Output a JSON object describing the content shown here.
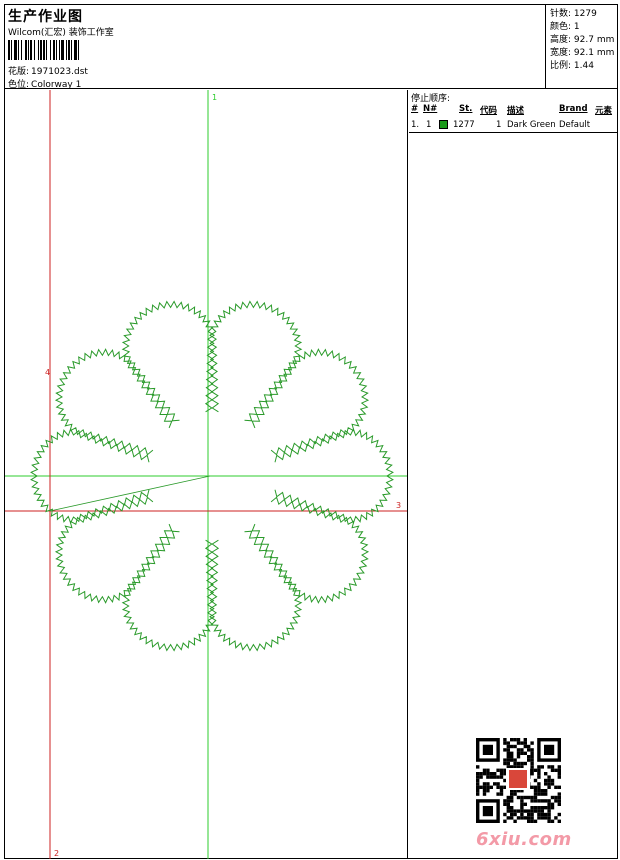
{
  "header": {
    "title": "生产作业图",
    "studio": "Wilcom(汇宏) 装饰工作室",
    "design_label": "花版:",
    "design_file": "1971023.dst",
    "colorway_label": "色位:",
    "colorway": "Colorway 1"
  },
  "stats": {
    "stitches_label": "针数:",
    "stitches": "1279",
    "colors_label": "颜色:",
    "colors": "1",
    "height_label": "高度:",
    "height": "92.7 mm",
    "width_label": "宽度:",
    "width": "92.1 mm",
    "ratio_label": "比例:",
    "ratio": "1.44"
  },
  "canvas": {
    "marker_top": "1",
    "marker_bottom": "2",
    "marker_right": "3",
    "marker_left": "4"
  },
  "stop_sequence": {
    "title": "停止顺序:",
    "headers": [
      "#",
      "N#",
      "St.",
      "代码",
      "描述",
      "Brand",
      "元素"
    ],
    "rows": [
      {
        "index": "1.",
        "needle": "1",
        "stitches": "1277",
        "code": "1",
        "description": "Dark Green",
        "brand": "Default",
        "color": "#1a9a1a"
      }
    ]
  },
  "watermark": {
    "logo": "6xiu.com"
  },
  "colors": {
    "stitch": "#2a9a2a",
    "guide_green": "#2ecc2e",
    "guide_red": "#cc2222"
  }
}
